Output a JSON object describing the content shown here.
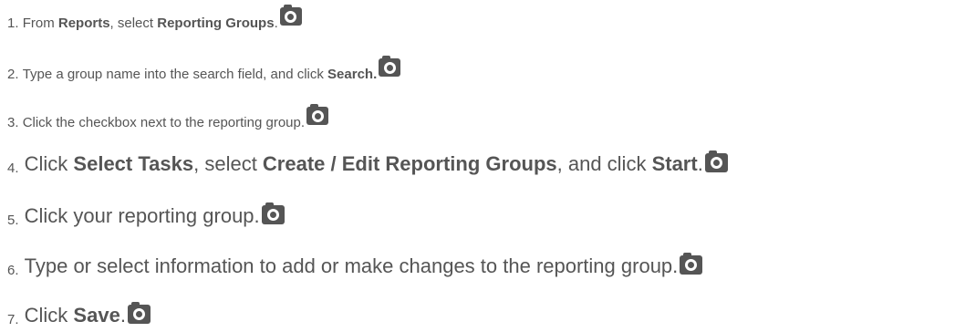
{
  "steps": [
    {
      "number": "1.",
      "parts": [
        {
          "text": "From ",
          "bold": false
        },
        {
          "text": "Reports",
          "bold": true
        },
        {
          "text": ", select ",
          "bold": false
        },
        {
          "text": "Reporting Groups",
          "bold": true
        },
        {
          "text": ".",
          "bold": false
        }
      ],
      "size": "small",
      "icon": "camera-icon"
    },
    {
      "number": "2.",
      "parts": [
        {
          "text": "Type a group name into the search field, and click ",
          "bold": false
        },
        {
          "text": "Search.",
          "bold": true
        }
      ],
      "size": "small",
      "icon": "camera-icon"
    },
    {
      "number": "3.",
      "parts": [
        {
          "text": "Click the checkbox next to the reporting group.",
          "bold": false
        }
      ],
      "size": "small",
      "icon": "camera-icon"
    },
    {
      "number": "4.",
      "parts": [
        {
          "text": "Click ",
          "bold": false
        },
        {
          "text": "Select Tasks",
          "bold": true
        },
        {
          "text": ", select ",
          "bold": false
        },
        {
          "text": "Create / Edit Reporting Groups",
          "bold": true
        },
        {
          "text": ", and click ",
          "bold": false
        },
        {
          "text": "Start",
          "bold": true
        },
        {
          "text": ".",
          "bold": false
        }
      ],
      "size": "large",
      "icon": "camera-icon"
    },
    {
      "number": "5.",
      "parts": [
        {
          "text": "Click your reporting group.",
          "bold": false
        }
      ],
      "size": "large",
      "icon": "camera-icon"
    },
    {
      "number": "6.",
      "parts": [
        {
          "text": "Type or select information to add or make changes to the reporting group.",
          "bold": false
        }
      ],
      "size": "large",
      "icon": "camera-icon"
    },
    {
      "number": "7.",
      "parts": [
        {
          "text": "Click ",
          "bold": false
        },
        {
          "text": "Save",
          "bold": true
        },
        {
          "text": ".",
          "bold": false
        }
      ],
      "size": "large",
      "icon": "camera-icon"
    }
  ],
  "colors": {
    "text": "#555555",
    "icon": "#555555"
  }
}
